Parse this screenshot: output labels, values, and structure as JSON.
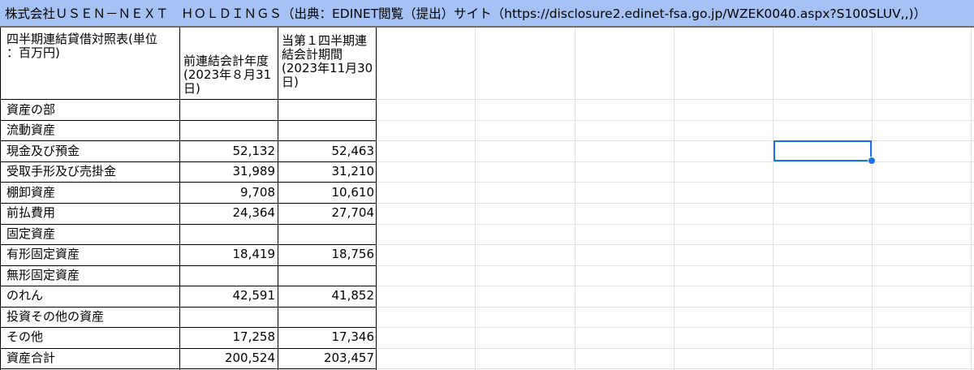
{
  "title": "株式会社ＵＳＥＮ－ＮＥＸＴ　ＨＯＬＤＩＮＧＳ（出典：EDINET閲覧（提出）サイト（https://disclosure2.edinet-fsa.go.jp/WZEK0040.aspx?S100SLUV,,)）",
  "table": {
    "header": {
      "label": "四半期連結貸借対照表(単位\n：百万円)",
      "col1": "前連結会計年度\n(2023年８月31\n日)",
      "col2": "当第１四半期連\n結会計期間\n(2023年11月30\n日)"
    },
    "rows": [
      {
        "label": "資産の部",
        "prev": "",
        "curr": ""
      },
      {
        "label": "流動資産",
        "prev": "",
        "curr": ""
      },
      {
        "label": "現金及び預金",
        "prev": "52,132",
        "curr": "52,463"
      },
      {
        "label": "受取手形及び売掛金",
        "prev": "31,989",
        "curr": "31,210"
      },
      {
        "label": "棚卸資産",
        "prev": "9,708",
        "curr": "10,610"
      },
      {
        "label": "前払費用",
        "prev": "24,364",
        "curr": "27,704"
      },
      {
        "label": "固定資産",
        "prev": "",
        "curr": ""
      },
      {
        "label": "有形固定資産",
        "prev": "18,419",
        "curr": "18,756"
      },
      {
        "label": "無形固定資産",
        "prev": "",
        "curr": ""
      },
      {
        "label": "のれん",
        "prev": "42,591",
        "curr": "41,852"
      },
      {
        "label": "投資その他の資産",
        "prev": "",
        "curr": ""
      },
      {
        "label": "その他",
        "prev": "17,258",
        "curr": "17,346"
      },
      {
        "label": "資産合計",
        "prev": "200,524",
        "curr": "203,457"
      }
    ]
  },
  "colors": {
    "title_bg": "#a4c2f4",
    "selection": "#1a73e8",
    "grid": "#e2e2e2"
  }
}
